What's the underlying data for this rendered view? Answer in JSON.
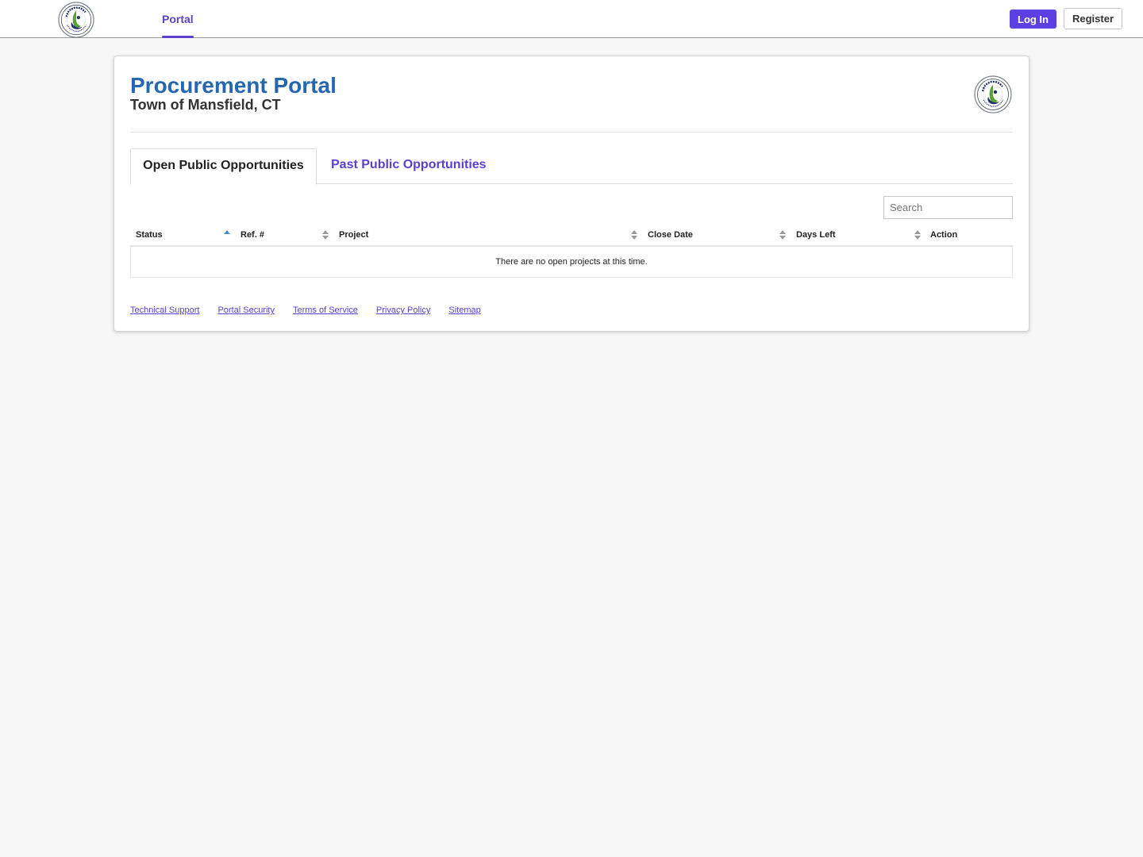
{
  "nav": {
    "logo_icon": "mansfield-town-seal-icon",
    "portal_label": "Portal",
    "login_label": "Log In",
    "register_label": "Register"
  },
  "header": {
    "title": "Procurement Portal",
    "subtitle": "Town of Mansfield, CT",
    "logo_icon": "mansfield-town-seal-icon"
  },
  "tabs": [
    {
      "label": "Open Public Opportunities",
      "active": true
    },
    {
      "label": "Past Public Opportunities",
      "active": false
    }
  ],
  "search": {
    "placeholder": "Search",
    "value": ""
  },
  "table": {
    "columns": [
      {
        "label": "Status",
        "sort": "ascending"
      },
      {
        "label": "Ref. #",
        "sort": "none"
      },
      {
        "label": "Project",
        "sort": "none"
      },
      {
        "label": "Close Date",
        "sort": "none"
      },
      {
        "label": "Days Left",
        "sort": "none"
      },
      {
        "label": "Action",
        "sort": "none"
      }
    ],
    "empty_message": "There are no open projects at this time."
  },
  "footer": {
    "links": [
      "Technical Support",
      "Portal Security",
      "Terms of Service",
      "Privacy Policy",
      "Sitemap"
    ]
  },
  "colors": {
    "brand_purple": "#5b3fd1",
    "title_blue": "#2767b0",
    "seal_green": "#5aa332",
    "seal_navy": "#23306b"
  }
}
